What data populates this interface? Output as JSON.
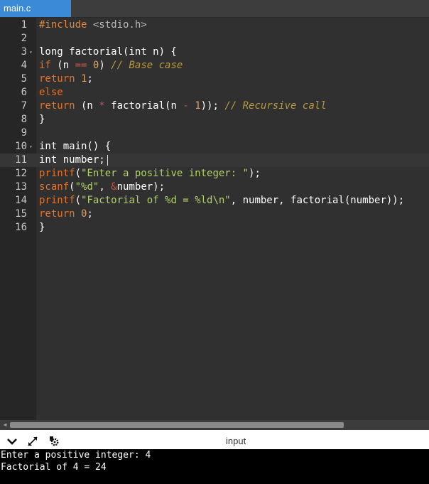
{
  "tab": {
    "label": "main.c",
    "accent": "#3b8ad8"
  },
  "editor": {
    "lines": [
      {
        "n": "1",
        "tokens": [
          {
            "c": "t-pre",
            "t": "#include "
          },
          {
            "c": "t-inc",
            "t": "<stdio.h>"
          }
        ]
      },
      {
        "n": "2",
        "tokens": []
      },
      {
        "n": "3",
        "fold": true,
        "tokens": [
          {
            "c": "t-id",
            "t": "long factorial(int n) {"
          }
        ]
      },
      {
        "n": "4",
        "tokens": [
          {
            "c": "t-kw",
            "t": "if"
          },
          {
            "c": "t-id",
            "t": " (n "
          },
          {
            "c": "t-op",
            "t": "=="
          },
          {
            "c": "t-id",
            "t": " "
          },
          {
            "c": "t-num",
            "t": "0"
          },
          {
            "c": "t-id",
            "t": ") "
          },
          {
            "c": "t-cm",
            "t": "// Base case"
          }
        ]
      },
      {
        "n": "5",
        "tokens": [
          {
            "c": "t-kw",
            "t": "return"
          },
          {
            "c": "t-id",
            "t": " "
          },
          {
            "c": "t-num",
            "t": "1"
          },
          {
            "c": "t-id",
            "t": ";"
          }
        ]
      },
      {
        "n": "6",
        "tokens": [
          {
            "c": "t-kw",
            "t": "else"
          }
        ]
      },
      {
        "n": "7",
        "tokens": [
          {
            "c": "t-kw",
            "t": "return"
          },
          {
            "c": "t-id",
            "t": " (n "
          },
          {
            "c": "t-op",
            "t": "*"
          },
          {
            "c": "t-id",
            "t": " factorial(n "
          },
          {
            "c": "t-op",
            "t": "-"
          },
          {
            "c": "t-id",
            "t": " "
          },
          {
            "c": "t-num",
            "t": "1"
          },
          {
            "c": "t-id",
            "t": ")); "
          },
          {
            "c": "t-cm",
            "t": "// Recursive call"
          }
        ]
      },
      {
        "n": "8",
        "tokens": [
          {
            "c": "t-id",
            "t": "}"
          }
        ]
      },
      {
        "n": "9",
        "tokens": []
      },
      {
        "n": "10",
        "fold": true,
        "tokens": [
          {
            "c": "t-id",
            "t": "int main() {"
          }
        ]
      },
      {
        "n": "11",
        "active": true,
        "tokens": [
          {
            "c": "t-id",
            "t": "int number;"
          }
        ]
      },
      {
        "n": "12",
        "tokens": [
          {
            "c": "t-kw",
            "t": "printf"
          },
          {
            "c": "t-id",
            "t": "("
          },
          {
            "c": "t-str",
            "t": "\"Enter a positive integer: \""
          },
          {
            "c": "t-id",
            "t": ");"
          }
        ]
      },
      {
        "n": "13",
        "tokens": [
          {
            "c": "t-kw",
            "t": "scanf"
          },
          {
            "c": "t-id",
            "t": "("
          },
          {
            "c": "t-str",
            "t": "\"%d\""
          },
          {
            "c": "t-id",
            "t": ", "
          },
          {
            "c": "t-op",
            "t": "&"
          },
          {
            "c": "t-id",
            "t": "number);"
          }
        ]
      },
      {
        "n": "14",
        "tokens": [
          {
            "c": "t-kw",
            "t": "printf"
          },
          {
            "c": "t-id",
            "t": "("
          },
          {
            "c": "t-str",
            "t": "\"Factorial of %d = %ld\\n\""
          },
          {
            "c": "t-id",
            "t": ", number, factorial(number));"
          }
        ]
      },
      {
        "n": "15",
        "tokens": [
          {
            "c": "t-kw",
            "t": "return"
          },
          {
            "c": "t-id",
            "t": " "
          },
          {
            "c": "t-num",
            "t": "0"
          },
          {
            "c": "t-id",
            "t": ";"
          }
        ]
      },
      {
        "n": "16",
        "tokens": [
          {
            "c": "t-id",
            "t": "}"
          }
        ]
      }
    ]
  },
  "io_panel": {
    "title": "input",
    "toolbar_icons": [
      "chevron-down-icon",
      "expand-icon",
      "settings-icon"
    ],
    "console_lines": [
      "Enter a positive integer: 4",
      "Factorial of 4 = 24"
    ]
  }
}
